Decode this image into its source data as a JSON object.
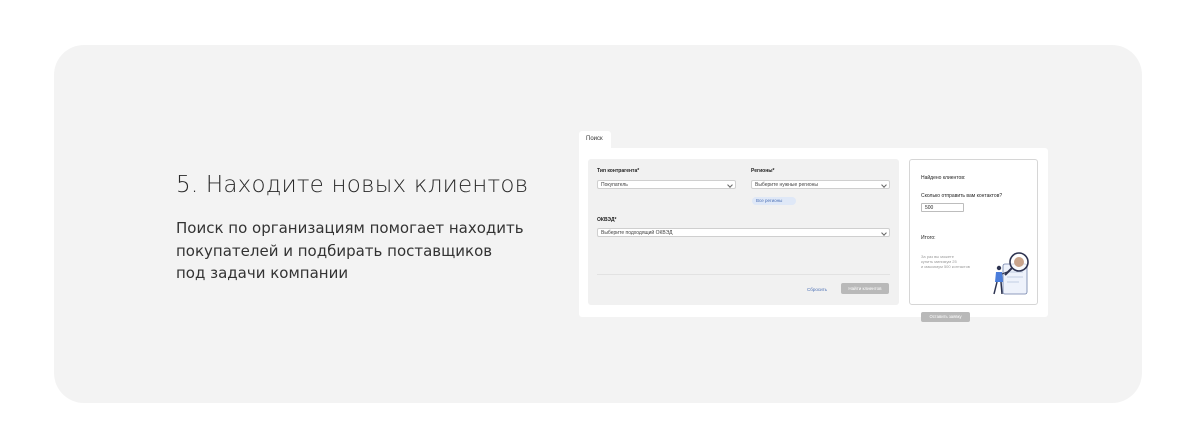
{
  "headline": "5. Находите новых клиентов",
  "description": [
    "Поиск по организациям помогает находить",
    "покупателей и подбирать поставщиков",
    "под задачи компании"
  ],
  "mock": {
    "tab_label": "Поиск",
    "form": {
      "counterparty_label": "Тип контрагента*",
      "counterparty_value": "Покупатель",
      "regions_label": "Регионы*",
      "regions_placeholder": "Выберите нужные регионы",
      "regions_chip": "Все регионы",
      "okved_label": "ОКВЭД*",
      "okved_placeholder": "Выберите подходящий ОКВЭД",
      "reset_label": "Сбросить",
      "find_label": "Найти клиентов"
    },
    "side": {
      "found_label": "Найдено клиентов:",
      "send_question": "Сколько отправить вам контактов?",
      "send_value": "500",
      "total_label": "Итого:",
      "promo_lines": [
        "За раз вы можете",
        "купить минимум 25",
        "и максимум 500 контактов"
      ],
      "order_label": "Оставить заявку"
    }
  },
  "colors": {
    "card_bg": "#f3f3f3",
    "accent": "#4a6fb5",
    "button_disabled": "#b9b9b9"
  }
}
